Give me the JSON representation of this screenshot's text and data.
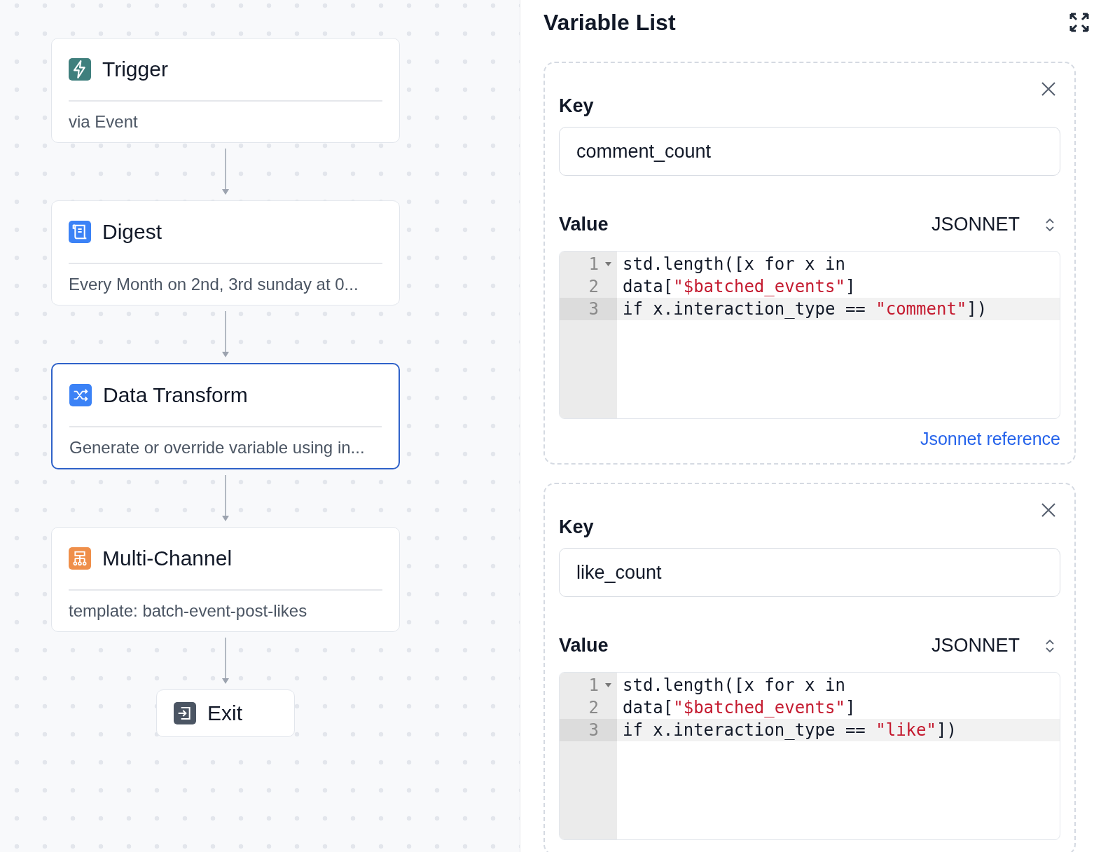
{
  "workflow": {
    "nodes": [
      {
        "kind": "trigger",
        "title": "Trigger",
        "subtitle": "via Event",
        "selected": false
      },
      {
        "kind": "digest",
        "title": "Digest",
        "subtitle": "Every Month on 2nd, 3rd sunday at 0...",
        "selected": false
      },
      {
        "kind": "transform",
        "title": "Data Transform",
        "subtitle": "Generate or override variable using in...",
        "selected": true
      },
      {
        "kind": "channel",
        "title": "Multi-Channel",
        "subtitle": "template: batch-event-post-likes",
        "selected": false
      },
      {
        "kind": "exit",
        "title": "Exit",
        "selected": false
      }
    ]
  },
  "panel": {
    "title": "Variable List",
    "variables": [
      {
        "key_label": "Key",
        "key": "comment_count",
        "value_label": "Value",
        "language": "JSONNET",
        "code": [
          {
            "number": "1",
            "foldable": true,
            "active": false,
            "tokens": [
              {
                "text": "std.length([x for x in",
                "kind": "plain"
              }
            ]
          },
          {
            "number": "2",
            "foldable": false,
            "active": false,
            "tokens": [
              {
                "text": "data[",
                "kind": "plain"
              },
              {
                "text": "\"$batched_events\"",
                "kind": "string"
              },
              {
                "text": "]",
                "kind": "plain"
              }
            ]
          },
          {
            "number": "3",
            "foldable": false,
            "active": true,
            "tokens": [
              {
                "text": "if x.interaction_type == ",
                "kind": "plain"
              },
              {
                "text": "\"comment\"",
                "kind": "string"
              },
              {
                "text": "])",
                "kind": "plain"
              }
            ]
          }
        ],
        "link": "Jsonnet reference"
      },
      {
        "key_label": "Key",
        "key": "like_count",
        "value_label": "Value",
        "language": "JSONNET",
        "code": [
          {
            "number": "1",
            "foldable": true,
            "active": false,
            "tokens": [
              {
                "text": "std.length([x for x in",
                "kind": "plain"
              }
            ]
          },
          {
            "number": "2",
            "foldable": false,
            "active": false,
            "tokens": [
              {
                "text": "data[",
                "kind": "plain"
              },
              {
                "text": "\"$batched_events\"",
                "kind": "string"
              },
              {
                "text": "]",
                "kind": "plain"
              }
            ]
          },
          {
            "number": "3",
            "foldable": false,
            "active": true,
            "tokens": [
              {
                "text": "if x.interaction_type == ",
                "kind": "plain"
              },
              {
                "text": "\"like\"",
                "kind": "string"
              },
              {
                "text": "])",
                "kind": "plain"
              }
            ]
          }
        ]
      }
    ]
  }
}
